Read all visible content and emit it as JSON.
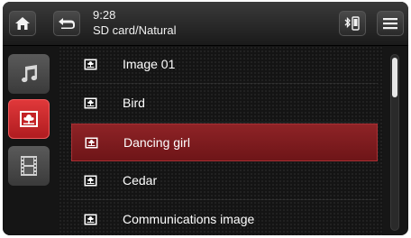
{
  "header": {
    "time": "9:28",
    "path": "SD card/Natural"
  },
  "sidenav": {
    "items": [
      {
        "name": "music",
        "icon": "music-note-icon",
        "selected": false
      },
      {
        "name": "photo",
        "icon": "photo-icon",
        "selected": true
      },
      {
        "name": "video",
        "icon": "film-icon",
        "selected": false
      }
    ]
  },
  "list": {
    "items": [
      {
        "label": "Image 01",
        "selected": false
      },
      {
        "label": "Bird",
        "selected": false
      },
      {
        "label": "Dancing girl",
        "selected": true
      },
      {
        "label": "Cedar",
        "selected": false
      },
      {
        "label": "Communications image",
        "selected": false
      }
    ]
  },
  "scrollbar": {
    "position": 0.0
  },
  "colors": {
    "accent": "#c8262a",
    "selected_row": "#7e1c1f",
    "background": "#141414"
  }
}
